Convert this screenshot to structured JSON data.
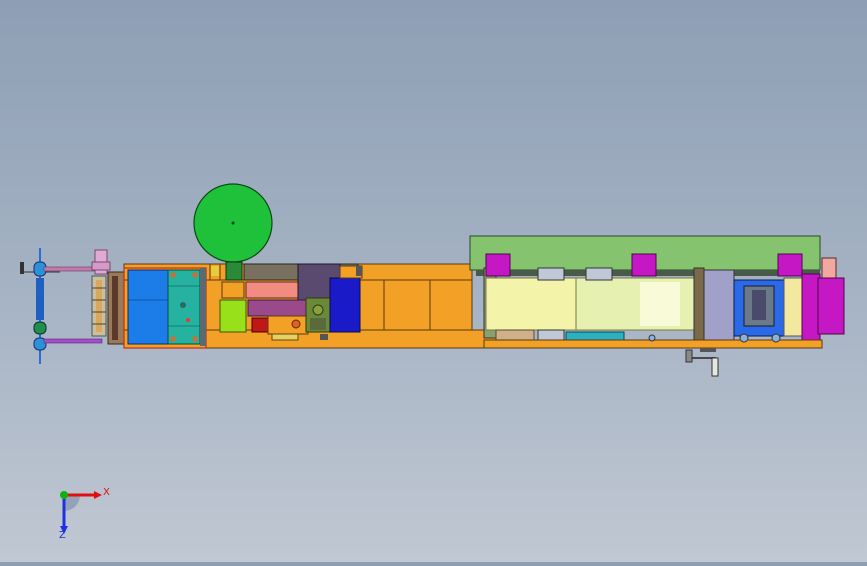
{
  "window": {
    "title": ""
  },
  "viewport": {
    "background_top": "#8e9eb4",
    "background_bottom": "#c0c8d2"
  },
  "model": {
    "name": "",
    "view": "top"
  },
  "triad": {
    "x_label": "X",
    "z_label": "Z",
    "x_color": "#e01010",
    "y_color": "#10b010",
    "z_color": "#2030e0"
  },
  "colors": {
    "frame_orange": "#f3a027",
    "green_drum": "#1fc13a",
    "cover_green": "#86c36e",
    "blue_block": "#1d7de8",
    "teal_block": "#26b2a0",
    "magenta_motor": "#c517c3",
    "pale_yellow": "#f3f3aa",
    "navy_block": "#1a1ac8",
    "lime_block": "#98e01a"
  }
}
